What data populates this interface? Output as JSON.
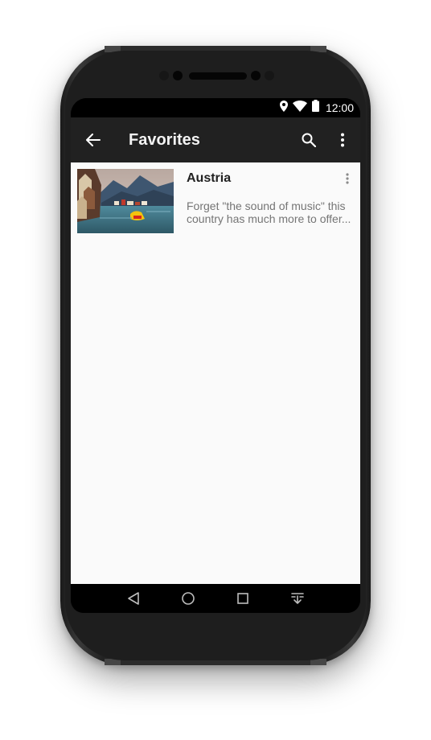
{
  "statusbar": {
    "time": "12:00",
    "icons": [
      "location-icon",
      "wifi-icon",
      "battery-icon"
    ]
  },
  "appbar": {
    "title": "Favorites",
    "back_icon": "arrow-back-icon",
    "actions": [
      "search-icon",
      "more-vert-icon"
    ]
  },
  "favorites": [
    {
      "title": "Austria",
      "description": "Forget \"the sound of music\" this country has much more to offer...",
      "image": "lakeside-village-thumbnail",
      "menu_icon": "more-vert-icon"
    }
  ],
  "navbar": {
    "buttons": [
      "back-triangle-icon",
      "home-circle-icon",
      "recents-square-icon",
      "notifications-pulldown-icon"
    ]
  },
  "colors": {
    "appbar": "#212121",
    "statusbar": "#000000",
    "content_bg": "#fafafa",
    "title_text": "#212121",
    "secondary_text": "#757575"
  }
}
